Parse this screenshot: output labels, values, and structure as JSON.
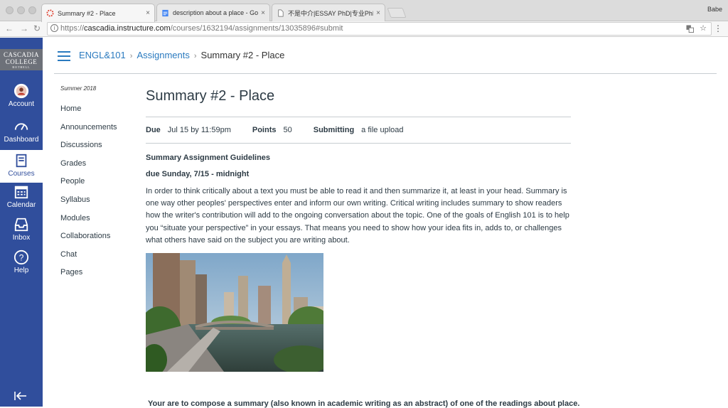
{
  "browser": {
    "tabs": [
      {
        "label": "Summary #2 - Place",
        "close": "×"
      },
      {
        "label": "description about a place - Go",
        "close": "×"
      },
      {
        "label": "不是中介|ESSAY PhD|专业PhD",
        "close": "×"
      }
    ],
    "profile": "Babe",
    "url_scheme": "https://",
    "url_host": "cascadia.instructure.com",
    "url_path": "/courses/1632194/assignments/13035896#submit"
  },
  "globalnav": {
    "logo_line1": "CASCADIA",
    "logo_line2": "COLLEGE",
    "logo_line3": "BOTHELL",
    "items": [
      {
        "label": "Account"
      },
      {
        "label": "Dashboard"
      },
      {
        "label": "Courses"
      },
      {
        "label": "Calendar"
      },
      {
        "label": "Inbox"
      },
      {
        "label": "Help"
      }
    ]
  },
  "breadcrumb": {
    "course": "ENGL&101",
    "section": "Assignments",
    "current": "Summary #2 - Place"
  },
  "coursenav": {
    "term": "Summer 2018",
    "items": [
      "Home",
      "Announcements",
      "Discussions",
      "Grades",
      "People",
      "Syllabus",
      "Modules",
      "Collaborations",
      "Chat",
      "Pages"
    ]
  },
  "assignment": {
    "title": "Summary #2 - Place",
    "due_label": "Due",
    "due_value": "Jul 15 by 11:59pm",
    "points_label": "Points",
    "points_value": "50",
    "submitting_label": "Submitting",
    "submitting_value": "a file upload",
    "heading": "Summary Assignment Guidelines",
    "due_heading": "due Sunday, 7/15 - midnight",
    "paragraph": " In order to think critically about a text you must be able to read it and then summarize it, at least in your head. Summary is one way other peoples' perspectives enter and inform our own writing. Critical writing includes summary to show readers how the writer's contribution will add to the ongoing conversation about the topic. One of the goals of English 101 is to help you “situate your perspective” in your essays. That means you need to show how your idea fits in, adds to, or challenges what others have said on the subject you are writing about.",
    "bottom_text": "Your are to compose a summary (also known in academic writing as an abstract) of one of the readings about place."
  }
}
